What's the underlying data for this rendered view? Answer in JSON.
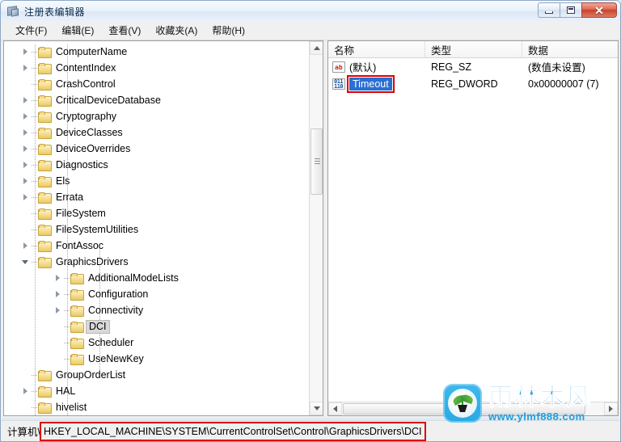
{
  "window": {
    "title": "注册表编辑器",
    "icon": "registry-editor-icon",
    "buttons": {
      "minimize": "最小化",
      "maximize": "最大化",
      "close": "✕"
    }
  },
  "menubar": {
    "items": [
      {
        "label": "文件(F)",
        "name": "menu-file"
      },
      {
        "label": "编辑(E)",
        "name": "menu-edit"
      },
      {
        "label": "查看(V)",
        "name": "menu-view"
      },
      {
        "label": "收藏夹(A)",
        "name": "menu-favorites"
      },
      {
        "label": "帮助(H)",
        "name": "menu-help"
      }
    ]
  },
  "tree": {
    "nodes": [
      {
        "label": "ComputerName",
        "depth": 1,
        "state": "collapsed",
        "selected": false
      },
      {
        "label": "ContentIndex",
        "depth": 1,
        "state": "collapsed",
        "selected": false
      },
      {
        "label": "CrashControl",
        "depth": 1,
        "state": "leaf",
        "selected": false
      },
      {
        "label": "CriticalDeviceDatabase",
        "depth": 1,
        "state": "collapsed",
        "selected": false
      },
      {
        "label": "Cryptography",
        "depth": 1,
        "state": "collapsed",
        "selected": false
      },
      {
        "label": "DeviceClasses",
        "depth": 1,
        "state": "collapsed",
        "selected": false
      },
      {
        "label": "DeviceOverrides",
        "depth": 1,
        "state": "collapsed",
        "selected": false
      },
      {
        "label": "Diagnostics",
        "depth": 1,
        "state": "collapsed",
        "selected": false
      },
      {
        "label": "Els",
        "depth": 1,
        "state": "collapsed",
        "selected": false
      },
      {
        "label": "Errata",
        "depth": 1,
        "state": "collapsed",
        "selected": false
      },
      {
        "label": "FileSystem",
        "depth": 1,
        "state": "leaf",
        "selected": false
      },
      {
        "label": "FileSystemUtilities",
        "depth": 1,
        "state": "leaf",
        "selected": false
      },
      {
        "label": "FontAssoc",
        "depth": 1,
        "state": "collapsed",
        "selected": false
      },
      {
        "label": "GraphicsDrivers",
        "depth": 1,
        "state": "expanded",
        "selected": false
      },
      {
        "label": "AdditionalModeLists",
        "depth": 2,
        "state": "collapsed",
        "selected": false
      },
      {
        "label": "Configuration",
        "depth": 2,
        "state": "collapsed",
        "selected": false
      },
      {
        "label": "Connectivity",
        "depth": 2,
        "state": "collapsed",
        "selected": false
      },
      {
        "label": "DCI",
        "depth": 2,
        "state": "leaf",
        "selected": true
      },
      {
        "label": "Scheduler",
        "depth": 2,
        "state": "leaf",
        "selected": false
      },
      {
        "label": "UseNewKey",
        "depth": 2,
        "state": "leaf",
        "selected": false
      },
      {
        "label": "GroupOrderList",
        "depth": 1,
        "state": "leaf",
        "selected": false
      },
      {
        "label": "HAL",
        "depth": 1,
        "state": "collapsed",
        "selected": false
      },
      {
        "label": "hivelist",
        "depth": 1,
        "state": "leaf",
        "selected": false
      }
    ],
    "scrollbar": {
      "up_arrow": "▲",
      "down_arrow": "▼"
    }
  },
  "values": {
    "columns": [
      {
        "label": "名称",
        "name": "column-name"
      },
      {
        "label": "类型",
        "name": "column-type"
      },
      {
        "label": "数据",
        "name": "column-data"
      }
    ],
    "rows": [
      {
        "icon": "string-value-icon",
        "name": "(默认)",
        "type": "REG_SZ",
        "data": "(数值未设置)",
        "selected": false,
        "highlighted": false
      },
      {
        "icon": "dword-value-icon",
        "name": "Timeout",
        "type": "REG_DWORD",
        "data": "0x00000007 (7)",
        "selected": true,
        "highlighted": true
      }
    ],
    "hscrollbar": {
      "left_arrow": "◀",
      "right_arrow": "▶"
    }
  },
  "statusbar": {
    "prefix": "计算机\\",
    "path": "HKEY_LOCAL_MACHINE\\SYSTEM\\CurrentControlSet\\Control\\GraphicsDrivers\\DCI",
    "highlighted": true
  },
  "watermark": {
    "brand": "雨林木风",
    "url": "www.ylmf888.com",
    "logo": "sprout-in-pot-icon"
  },
  "colors": {
    "selection_blue": "#2a6fd4",
    "annotation_red": "#dd0000",
    "brand_blue": "#1f9fe0",
    "folder_yellow": "#ecc862",
    "close_button_red": "#c9422c"
  }
}
